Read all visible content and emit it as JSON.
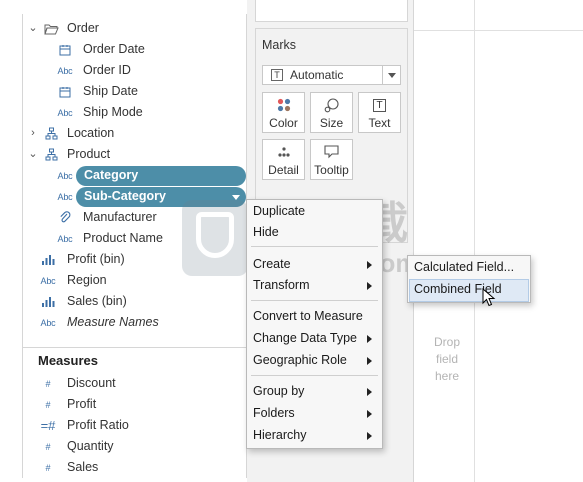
{
  "dimensions": {
    "order": {
      "label": "Order",
      "fields": [
        {
          "label": "Order Date",
          "icon": "calendar-icon"
        },
        {
          "label": "Order ID",
          "icon": "abc-icon",
          "icon_text": "Abc"
        },
        {
          "label": "Ship Date",
          "icon": "calendar-icon"
        },
        {
          "label": "Ship Mode",
          "icon": "abc-icon",
          "icon_text": "Abc"
        }
      ]
    },
    "location": {
      "label": "Location",
      "icon": "hierarchy-icon"
    },
    "product": {
      "label": "Product",
      "icon": "hierarchy-icon",
      "fields": [
        {
          "label": "Category",
          "icon": "abc-icon",
          "icon_text": "Abc",
          "selected": true
        },
        {
          "label": "Sub-Category",
          "icon": "abc-icon",
          "icon_text": "Abc",
          "selected": true
        },
        {
          "label": "Manufacturer",
          "icon": "paperclip-icon"
        },
        {
          "label": "Product Name",
          "icon": "abc-icon",
          "icon_text": "Abc"
        }
      ]
    },
    "others": [
      {
        "label": "Profit (bin)",
        "icon": "bin-icon"
      },
      {
        "label": "Region",
        "icon": "abc-icon",
        "icon_text": "Abc"
      },
      {
        "label": "Sales (bin)",
        "icon": "bin-icon"
      },
      {
        "label": "Measure Names",
        "icon": "abc-icon",
        "icon_text": "Abc"
      }
    ]
  },
  "measures": {
    "title": "Measures",
    "fields": [
      {
        "label": "Discount",
        "icon": "hash-icon"
      },
      {
        "label": "Profit",
        "icon": "hash-icon"
      },
      {
        "label": "Profit Ratio",
        "icon": "calc-hash-icon"
      },
      {
        "label": "Quantity",
        "icon": "hash-icon"
      },
      {
        "label": "Sales",
        "icon": "hash-icon"
      }
    ]
  },
  "marks": {
    "title": "Marks",
    "mark_type": "Automatic",
    "mark_type_icon": "T",
    "buttons": [
      {
        "label": "Color",
        "icon": "color-dots-icon"
      },
      {
        "label": "Size",
        "icon": "size-icon"
      },
      {
        "label": "Text",
        "icon": "text-icon",
        "icon_text": "T"
      },
      {
        "label": "Detail",
        "icon": "detail-dots-icon"
      },
      {
        "label": "Tooltip",
        "icon": "tooltip-icon"
      }
    ]
  },
  "canvas": {
    "drop_hint": [
      "Drop",
      "field",
      "here"
    ]
  },
  "context_menu": {
    "items": [
      {
        "label": "Duplicate",
        "submenu": false
      },
      {
        "label": "Hide",
        "submenu": false
      },
      {
        "label": "Create",
        "submenu": true
      },
      {
        "label": "Transform",
        "submenu": true
      },
      {
        "label": "Convert to Measure",
        "submenu": false
      },
      {
        "label": "Change Data Type",
        "submenu": true
      },
      {
        "label": "Geographic Role",
        "submenu": true
      },
      {
        "label": "Group by",
        "submenu": true
      },
      {
        "label": "Folders",
        "submenu": true
      },
      {
        "label": "Hierarchy",
        "submenu": true
      }
    ],
    "create_submenu": [
      {
        "label": "Calculated Field...",
        "highlighted": false
      },
      {
        "label": "Combined Field",
        "highlighted": true
      }
    ]
  },
  "watermark": {
    "cn_text": "安下载",
    "url_text": "anxz.com"
  },
  "colors": {
    "selection_pill": "#4d8ea8",
    "dimension_icon": "#3c6fa6",
    "measure_icon": "#2e8b57",
    "menu_highlight": "#dfe9f5"
  }
}
